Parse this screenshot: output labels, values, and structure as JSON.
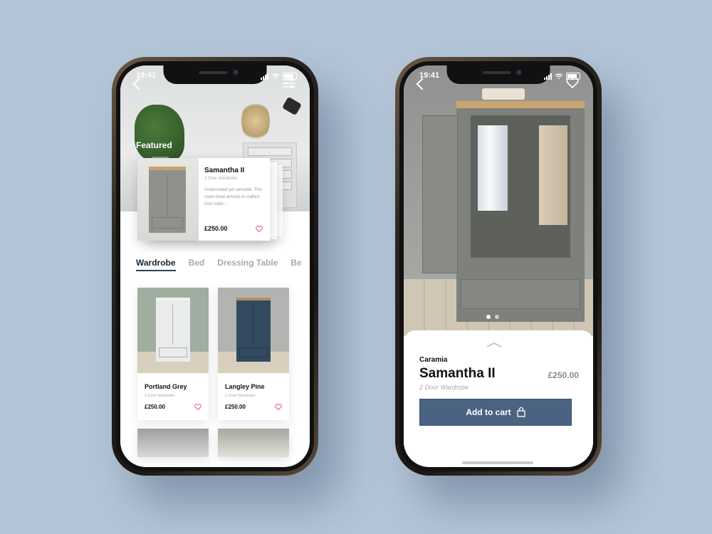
{
  "status": {
    "time": "19:41"
  },
  "listing": {
    "featured_label": "Featured",
    "featured_card": {
      "name": "Samantha II",
      "subtitle": "2 Door Wardrobe",
      "description": "Understated yet versatile. This clean-lined armoire is crafted from solid...",
      "price": "£250.00"
    },
    "tabs": [
      "Wardrobe",
      "Bed",
      "Dressing Table",
      "Be"
    ],
    "products": [
      {
        "name": "Portland Grey",
        "subtitle": "2 Door Wardrobe",
        "price": "£250.00",
        "color": "#e9eceb",
        "bg": "#9fae9f"
      },
      {
        "name": "Langley Pine",
        "subtitle": "2 Door Wardrobe",
        "price": "£250.00",
        "color": "#334a60",
        "bg": "#b2b4b1"
      }
    ]
  },
  "detail": {
    "brand": "Caramia",
    "name": "Samantha II",
    "price": "£250.00",
    "subtitle": "2 Door Wardrobe",
    "cart_label": "Add to cart",
    "carousel": {
      "count": 2,
      "active": 0
    }
  },
  "colors": {
    "accent": "#4a6382",
    "heart": "#e05a7a",
    "background": "#b4c5d8"
  },
  "icons": [
    "back-icon",
    "filter-icon",
    "heart-icon",
    "chevron-up-icon",
    "bag-icon",
    "signal-icon",
    "wifi-icon",
    "battery-icon"
  ]
}
